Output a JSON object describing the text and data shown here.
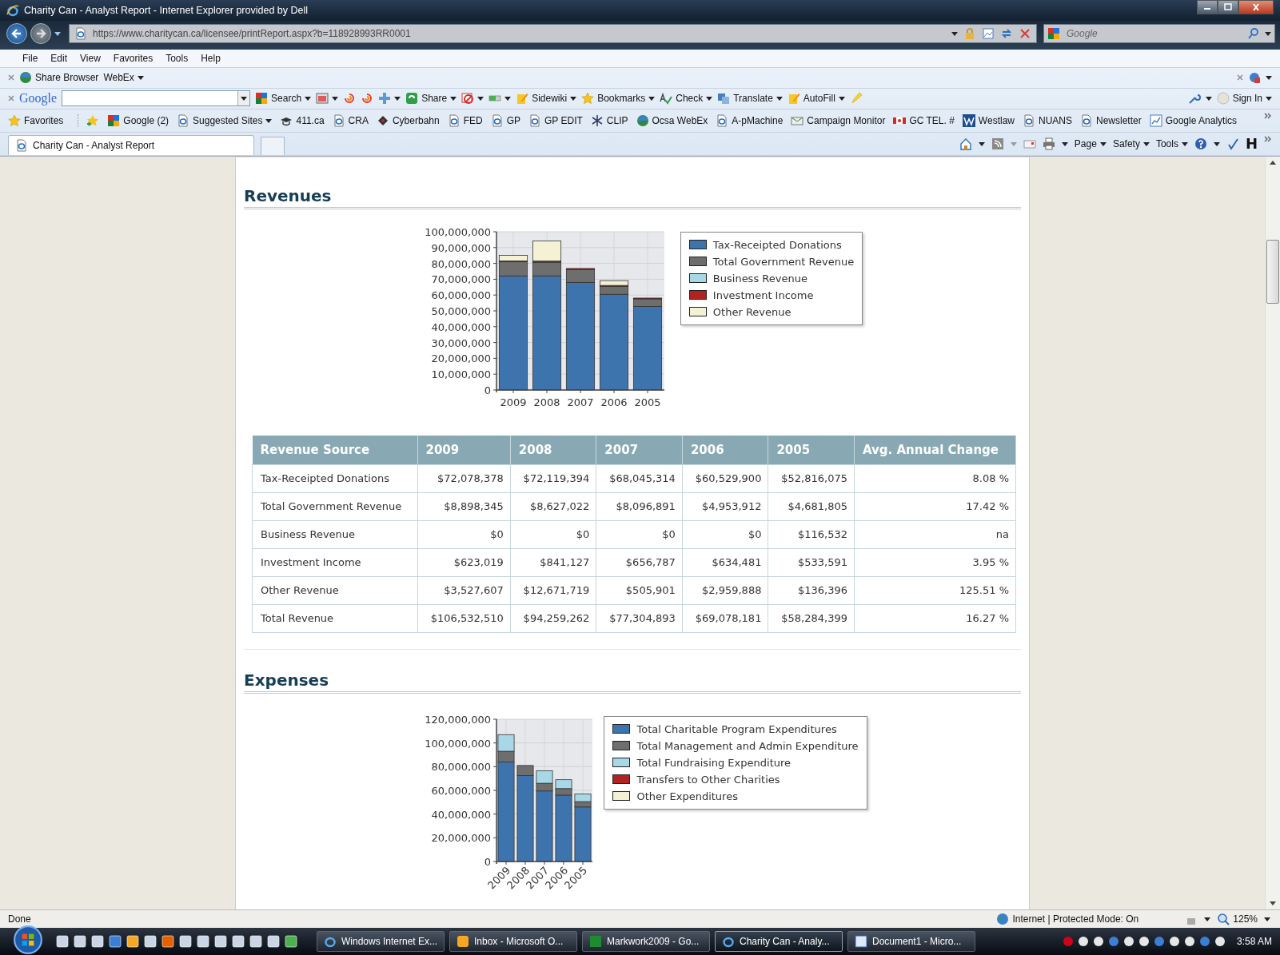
{
  "window": {
    "title": "Charity Can - Analyst Report - Internet Explorer provided by Dell"
  },
  "address_bar": {
    "url": "https://www.charitycan.ca/licensee/printReport.aspx?b=118928993RR0001",
    "search_placeholder": "Google"
  },
  "menu": [
    "File",
    "Edit",
    "View",
    "Favorites",
    "Tools",
    "Help"
  ],
  "share_toolbar": {
    "items": [
      {
        "label": "Share Browser",
        "kind": "globe",
        "dropdown": false
      },
      {
        "label": "WebEx",
        "kind": "none",
        "dropdown": true
      }
    ]
  },
  "google_toolbar": {
    "logo": "Google",
    "items": [
      {
        "label": "Search",
        "kind": "google",
        "dropdown": true
      },
      {
        "kind": "window",
        "dropdown": true
      },
      {
        "kind": "spiral",
        "dropdown": false
      },
      {
        "kind": "spiral",
        "dropdown": false
      },
      {
        "kind": "plus",
        "dropdown": true
      },
      {
        "label": "Share",
        "kind": "share",
        "dropdown": true
      },
      {
        "kind": "nosign",
        "dropdown": true
      },
      {
        "kind": "bar",
        "dropdown": true
      },
      {
        "label": "Sidewiki",
        "kind": "pencil",
        "dropdown": true
      },
      {
        "label": "Bookmarks",
        "kind": "star",
        "dropdown": true
      },
      {
        "label": "Check",
        "kind": "check",
        "dropdown": true
      },
      {
        "label": "Translate",
        "kind": "translate",
        "dropdown": true
      },
      {
        "label": "AutoFill",
        "kind": "pencil",
        "dropdown": true
      },
      {
        "kind": "highlighter",
        "dropdown": false
      }
    ],
    "sign_in": "Sign In"
  },
  "favorites_bar": {
    "label": "Favorites",
    "items": [
      {
        "label": "Google (2)",
        "kind": "google",
        "dropdown": false
      },
      {
        "label": "Suggested Sites",
        "kind": "page",
        "dropdown": true
      },
      {
        "label": "411.ca",
        "kind": "cap",
        "dropdown": false
      },
      {
        "label": "CRA",
        "kind": "page",
        "dropdown": false
      },
      {
        "label": "Cyberbahn",
        "kind": "diamond",
        "dropdown": false
      },
      {
        "label": "FED",
        "kind": "page",
        "dropdown": false
      },
      {
        "label": "GP",
        "kind": "page",
        "dropdown": false
      },
      {
        "label": "GP EDIT",
        "kind": "page",
        "dropdown": false
      },
      {
        "label": "CLIP",
        "kind": "snowflake",
        "dropdown": false
      },
      {
        "label": "Ocsa WebEx",
        "kind": "globe",
        "dropdown": false
      },
      {
        "label": "A-pMachine",
        "kind": "page",
        "dropdown": false
      },
      {
        "label": "Campaign Monitor",
        "kind": "mail",
        "dropdown": false
      },
      {
        "label": "GC TEL. #",
        "kind": "flag",
        "dropdown": false
      },
      {
        "label": "Westlaw",
        "kind": "w",
        "dropdown": false
      },
      {
        "label": "NUANS",
        "kind": "page",
        "dropdown": false
      },
      {
        "label": "Newsletter",
        "kind": "page",
        "dropdown": false
      },
      {
        "label": "Google Analytics",
        "kind": "chart",
        "dropdown": false
      }
    ]
  },
  "tabs": [
    {
      "label": "Charity Can - Analyst Report",
      "selected": true
    }
  ],
  "command_bar": {
    "menus": [
      "Page",
      "Safety",
      "Tools"
    ],
    "h_label": "H"
  },
  "report": {
    "sections": [
      {
        "title": "Revenues",
        "chart_data": {
          "type": "bar",
          "stacked": true,
          "grid": true,
          "categories": [
            "2009",
            "2008",
            "2007",
            "2006",
            "2005"
          ],
          "ylim": [
            0,
            100000000
          ],
          "yticks": [
            {
              "value": 0,
              "label": "0"
            },
            {
              "value": 10000000,
              "label": "10,000,000"
            },
            {
              "value": 20000000,
              "label": "20,000,000"
            },
            {
              "value": 30000000,
              "label": "30,000,000"
            },
            {
              "value": 40000000,
              "label": "40,000,000"
            },
            {
              "value": 50000000,
              "label": "50,000,000"
            },
            {
              "value": 60000000,
              "label": "60,000,000"
            },
            {
              "value": 70000000,
              "label": "70,000,000"
            },
            {
              "value": 80000000,
              "label": "80,000,000"
            },
            {
              "value": 90000000,
              "label": "90,000,000"
            },
            {
              "value": 100000000,
              "label": "100,000,000"
            }
          ],
          "series": [
            {
              "name": "Tax-Receipted Donations",
              "color": "#3e74ad",
              "values": [
                72100000,
                72100000,
                68000000,
                60500000,
                52800000
              ]
            },
            {
              "name": "Total Government Revenue",
              "color": "#6e6e6e",
              "values": [
                8900000,
                8600000,
                8100000,
                5000000,
                4700000
              ]
            },
            {
              "name": "Business Revenue",
              "color": "#a8d8e8",
              "values": [
                0,
                0,
                0,
                0,
                100000
              ]
            },
            {
              "name": "Investment Income",
              "color": "#b22222",
              "values": [
                600000,
                800000,
                700000,
                600000,
                500000
              ]
            },
            {
              "name": "Other Revenue",
              "color": "#f4f1d4",
              "values": [
                3500000,
                12700000,
                null,
                3000000,
                100000
              ]
            }
          ]
        },
        "table": {
          "columns": [
            "Revenue Source",
            "2009",
            "2008",
            "2007",
            "2006",
            "2005",
            "Avg. Annual Change"
          ],
          "rows": [
            [
              "Tax-Receipted Donations",
              "$72,078,378",
              "$72,119,394",
              "$68,045,314",
              "$60,529,900",
              "$52,816,075",
              "8.08 %"
            ],
            [
              "Total Government Revenue",
              "$8,898,345",
              "$8,627,022",
              "$8,096,891",
              "$4,953,912",
              "$4,681,805",
              "17.42 %"
            ],
            [
              "Business Revenue",
              "$0",
              "$0",
              "$0",
              "$0",
              "$116,532",
              "na"
            ],
            [
              "Investment Income",
              "$623,019",
              "$841,127",
              "$656,787",
              "$634,481",
              "$533,591",
              "3.95 %"
            ],
            [
              "Other Revenue",
              "$3,527,607",
              "$12,671,719",
              "$505,901",
              "$2,959,888",
              "$136,396",
              "125.51 %"
            ],
            [
              "Total Revenue",
              "$106,532,510",
              "$94,259,262",
              "$77,304,893",
              "$69,078,181",
              "$58,284,399",
              "16.27 %"
            ]
          ]
        }
      },
      {
        "title": "Expenses",
        "chart_data": {
          "type": "bar",
          "stacked": true,
          "grid": true,
          "categories": [
            "2009",
            "2008",
            "2007",
            "2006",
            "2005"
          ],
          "ylim": [
            0,
            120000000
          ],
          "yticks": [
            {
              "value": 0,
              "label": "0"
            },
            {
              "value": 20000000,
              "label": "20,000,000"
            },
            {
              "value": 40000000,
              "label": "40,000,000"
            },
            {
              "value": 60000000,
              "label": "60,000,000"
            },
            {
              "value": 80000000,
              "label": "80,000,000"
            },
            {
              "value": 100000000,
              "label": "100,000,000"
            },
            {
              "value": 120000000,
              "label": "120,000,000"
            }
          ],
          "series": [
            {
              "name": "Total Charitable Program Expenditures",
              "color": "#3e74ad",
              "values": [
                84000000,
                72500000,
                59500000,
                56000000,
                46000000
              ]
            },
            {
              "name": "Total Management and Admin Expenditure",
              "color": "#6e6e6e",
              "values": [
                9000000,
                8500000,
                6500000,
                5500000,
                4500000
              ]
            },
            {
              "name": "Total Fundraising Expenditure",
              "color": "#a8d8e8",
              "values": [
                14000000,
                500000,
                10500000,
                7500000,
                6500000
              ]
            },
            {
              "name": "Transfers to Other Charities",
              "color": "#b22222",
              "values": [
                0,
                0,
                0,
                0,
                0
              ]
            },
            {
              "name": "Other Expenditures",
              "color": "#f4f1d4",
              "values": [
                0,
                0,
                0,
                0,
                0
              ]
            }
          ]
        }
      }
    ]
  },
  "status_bar": {
    "text": "Done",
    "zone": "Internet | Protected Mode: On",
    "zoom": "125%"
  },
  "taskbar": {
    "buttons": [
      {
        "label": "Windows Internet Ex...",
        "kind": "ie",
        "selected": false
      },
      {
        "label": "Inbox - Microsoft O...",
        "kind": "outlook",
        "selected": false
      },
      {
        "label": "Markwork2009 - Go...",
        "kind": "mypc",
        "selected": false
      },
      {
        "label": "Charity Can - Analy...",
        "kind": "ie",
        "selected": true
      },
      {
        "label": "Document1 - Micro...",
        "kind": "word",
        "selected": false
      }
    ],
    "clock": "3:58 AM"
  }
}
